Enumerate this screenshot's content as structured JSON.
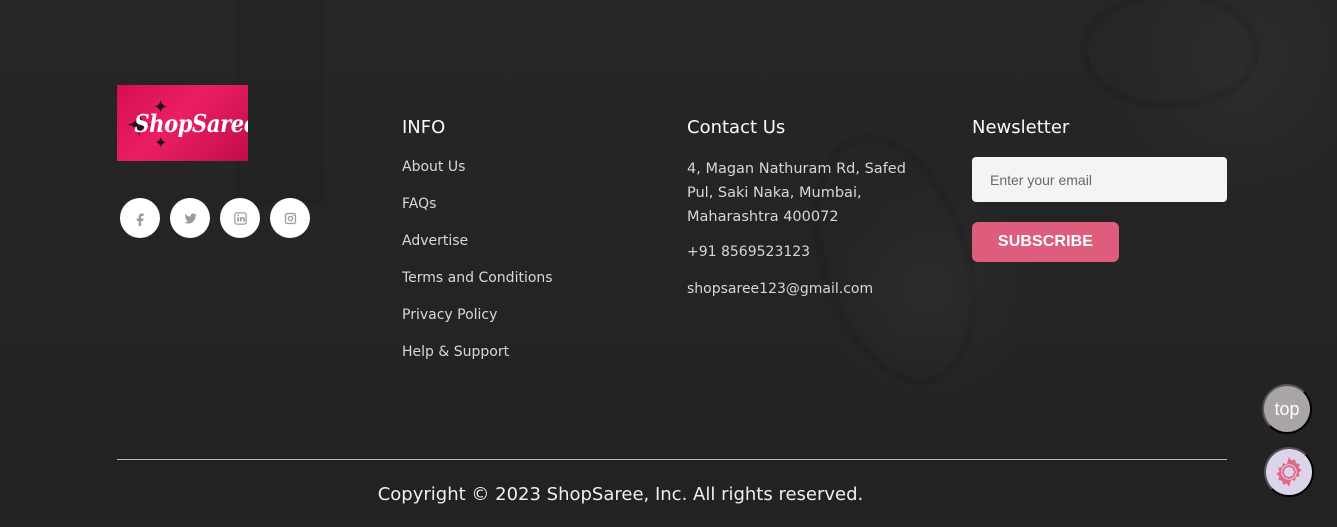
{
  "logo": {
    "text": "ShopSaree"
  },
  "social": [
    {
      "name": "facebook",
      "icon": "facebook-icon"
    },
    {
      "name": "twitter",
      "icon": "twitter-icon"
    },
    {
      "name": "linkedin",
      "icon": "linkedin-icon"
    },
    {
      "name": "instagram",
      "icon": "instagram-icon"
    }
  ],
  "info": {
    "title": "INFO",
    "items": [
      "About Us",
      "FAQs",
      "Advertise",
      "Terms and Conditions",
      "Privacy Policy",
      "Help & Support"
    ]
  },
  "contact": {
    "title": "Contact Us",
    "address": "4, Magan Nathuram Rd, Safed Pul, Saki Naka, Mumbai, Maharashtra 400072",
    "phone": "+91 8569523123",
    "email": "shopsaree123@gmail.com"
  },
  "newsletter": {
    "title": "Newsletter",
    "placeholder": "Enter your email",
    "button": "SUBSCRIBE"
  },
  "footer": {
    "copyright": "Copyright © 2023 ShopSaree, Inc. All rights reserved."
  },
  "floating": {
    "top_label": "top",
    "accessibility_icon": "accessibility-icon"
  },
  "colors": {
    "background": "#232325",
    "logo_pink": "#e61a5f",
    "subscribe": "#de5c7c",
    "top_button": "#a9a4a6",
    "accessibility_bg": "#dcd4ea"
  }
}
